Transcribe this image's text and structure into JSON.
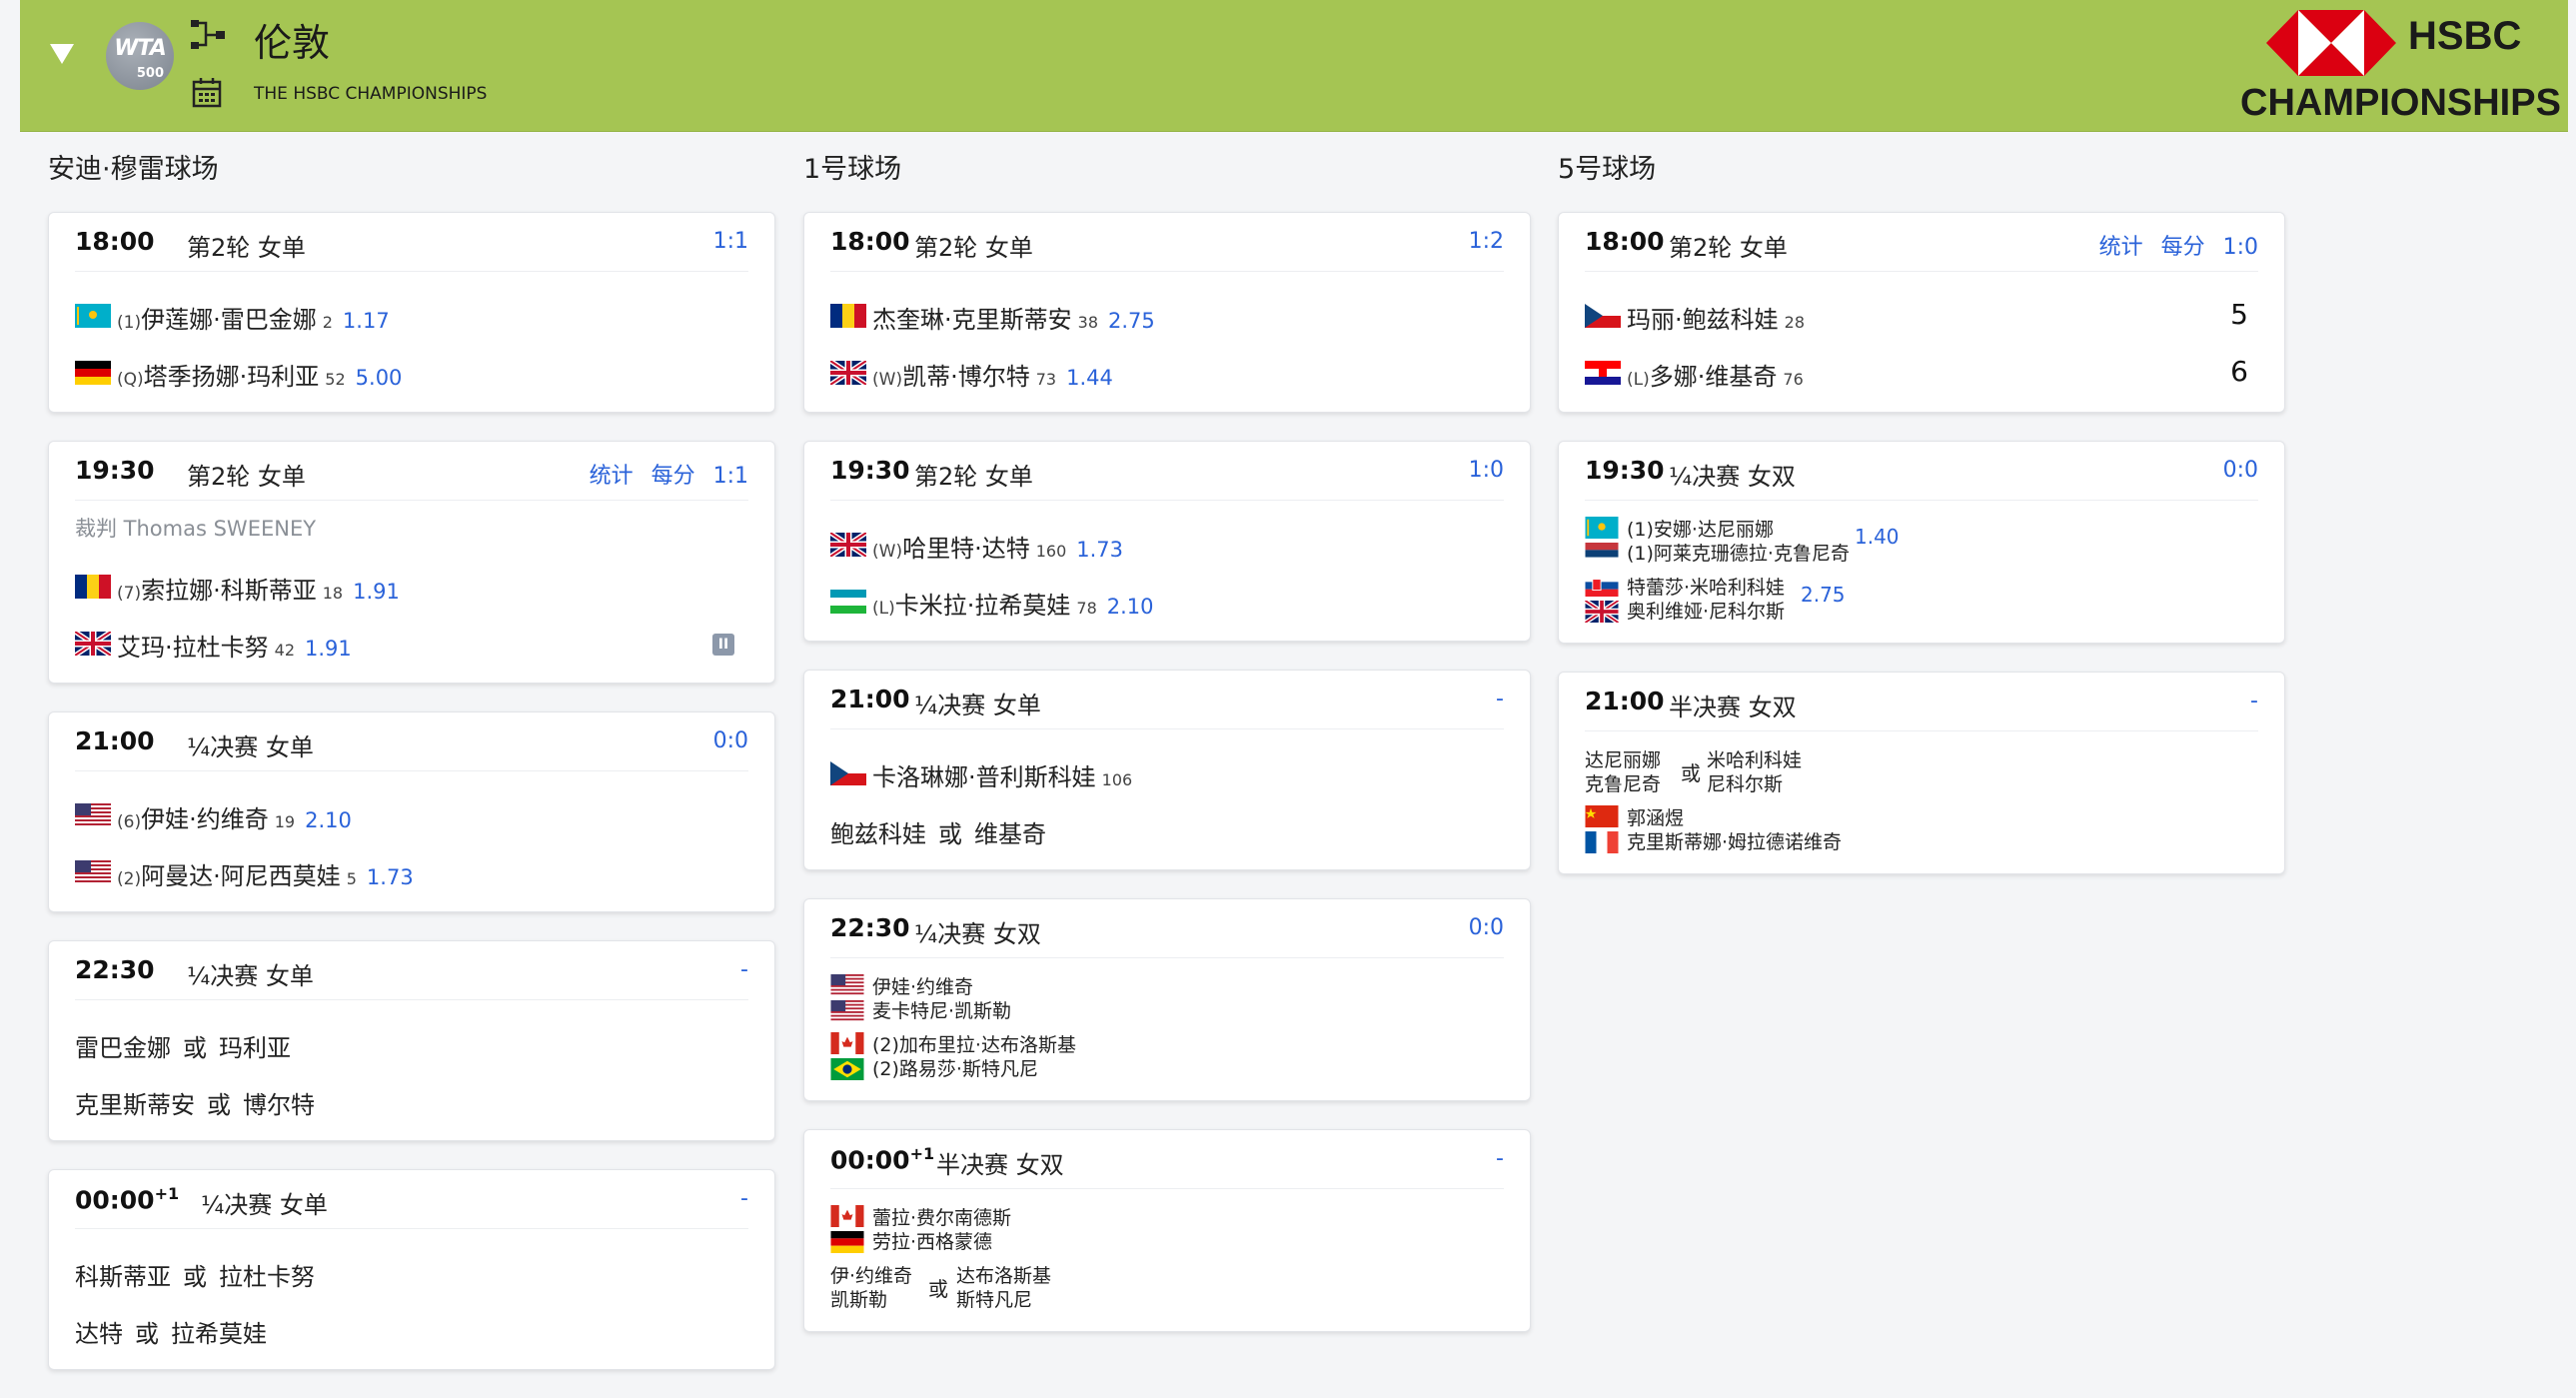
{
  "header": {
    "title": "伦敦",
    "subtitle": "THE HSBC CHAMPIONSHIPS",
    "logo_text": "WTA",
    "logo_tier": "500",
    "sponsor_word": "HSBC",
    "sponsor_champ": "CHAMPIONSHIPS",
    "icons": [
      "collapse-arrow-icon",
      "bracket-icon",
      "calendar-icon"
    ]
  },
  "courts": [
    {
      "title": "安迪·穆雷球场",
      "matches": [
        {
          "time": "18:00",
          "round": "第2轮 女单",
          "score": "1:1",
          "players": [
            {
              "flag": "KZ",
              "seed": "(1)",
              "name": "伊莲娜·雷巴金娜",
              "rank": "2",
              "odds": "1.17"
            },
            {
              "flag": "DE",
              "seed": "(Q)",
              "name": "塔季扬娜·玛利亚",
              "rank": "52",
              "odds": "5.00"
            }
          ]
        },
        {
          "time": "19:30",
          "round": "第2轮 女单",
          "stats": "统计",
          "perpoint": "每分",
          "score": "1:1",
          "referee": "裁判  Thomas SWEENEY",
          "players": [
            {
              "flag": "RO",
              "seed": "(7)",
              "name": "索拉娜·科斯蒂亚",
              "rank": "18",
              "odds": "1.91"
            },
            {
              "flag": "GB",
              "seed": "",
              "name": "艾玛·拉杜卡努",
              "rank": "42",
              "odds": "1.91"
            }
          ]
        },
        {
          "time": "21:00",
          "round": "¼决赛 女单",
          "score": "0:0",
          "players": [
            {
              "flag": "US",
              "seed": "(6)",
              "name": "伊娃·约维奇",
              "rank": "19",
              "odds": "2.10"
            },
            {
              "flag": "US",
              "seed": "(2)",
              "name": "阿曼达·阿尼西莫娃",
              "rank": "5",
              "odds": "1.73"
            }
          ]
        },
        {
          "time": "22:30",
          "round": "¼决赛 女单",
          "score": "-",
          "pending": [
            {
              "a": "雷巴金娜",
              "or": "或",
              "b": "玛利亚"
            },
            {
              "a": "克里斯蒂安",
              "or": "或",
              "b": "博尔特"
            }
          ]
        },
        {
          "time": "00:00",
          "plus": "+1",
          "round": "¼决赛 女单",
          "score": "-",
          "pending": [
            {
              "a": "科斯蒂亚",
              "or": "或",
              "b": "拉杜卡努"
            },
            {
              "a": "达特",
              "or": "或",
              "b": "拉希莫娃"
            }
          ]
        }
      ]
    },
    {
      "title": "1号球场",
      "matches": [
        {
          "time": "18:00",
          "round": "第2轮 女单",
          "score": "1:2",
          "players": [
            {
              "flag": "RO",
              "seed": "",
              "name": "杰奎琳·克里斯蒂安",
              "rank": "38",
              "odds": "2.75"
            },
            {
              "flag": "GB",
              "seed": "(W)",
              "name": "凯蒂·博尔特",
              "rank": "73",
              "odds": "1.44"
            }
          ]
        },
        {
          "time": "19:30",
          "round": "第2轮 女单",
          "score": "1:0",
          "players": [
            {
              "flag": "GB",
              "seed": "(W)",
              "name": "哈里特·达特",
              "rank": "160",
              "odds": "1.73"
            },
            {
              "flag": "UZ",
              "seed": "(L)",
              "name": "卡米拉·拉希莫娃",
              "rank": "78",
              "odds": "2.10"
            }
          ]
        },
        {
          "time": "21:00",
          "round": "¼决赛 女单",
          "score": "-",
          "player": {
            "flag": "CZ",
            "name": "卡洛琳娜·普利斯科娃",
            "rank": "106"
          },
          "pending": {
            "a": "鲍兹科娃",
            "or": "或",
            "b": "维基奇"
          }
        },
        {
          "time": "22:30",
          "round": "¼决赛 女双",
          "score": "0:0",
          "pairs": [
            {
              "flags": [
                "US",
                "US"
              ],
              "n1": "伊娃·约维奇",
              "n2": "麦卡特尼·凯斯勒"
            },
            {
              "flags": [
                "CA",
                "BR"
              ],
              "n1": "(2)加布里拉·达布洛斯基",
              "n2": "(2)路易莎·斯特凡尼"
            }
          ]
        },
        {
          "time": "00:00",
          "plus": "+1",
          "round": "半决赛 女双",
          "score": "-",
          "pair": {
            "flags": [
              "CA",
              "DE"
            ],
            "n1": "蕾拉·费尔南德斯",
            "n2": "劳拉·西格蒙德"
          },
          "pending": {
            "a1": "伊·约维奇",
            "a2": "凯斯勒",
            "or": "或",
            "b1": "达布洛斯基",
            "b2": "斯特凡尼"
          }
        }
      ]
    },
    {
      "title": "5号球场",
      "matches": [
        {
          "time": "18:00",
          "round": "第2轮 女单",
          "stats": "统计",
          "perpoint": "每分",
          "score": "1:0",
          "players": [
            {
              "flag": "CZ",
              "seed": "",
              "name": "玛丽·鲍兹科娃",
              "rank": "28",
              "set": "5"
            },
            {
              "flag": "HR",
              "seed": "(L)",
              "name": "多娜·维基奇",
              "rank": "76",
              "set": "6"
            }
          ]
        },
        {
          "time": "19:30",
          "round": "¼决赛 女双",
          "score": "0:0",
          "pairs": [
            {
              "flags": [
                "KZ",
                "RS"
              ],
              "n1": "(1)安娜·达尼丽娜",
              "n2": "(1)阿莱克珊德拉·克鲁尼奇",
              "odds": "1.40"
            },
            {
              "flags": [
                "SK",
                "GB"
              ],
              "n1": "特蕾莎·米哈利科娃",
              "n2": "奥利维娅·尼科尔斯",
              "odds": "2.75"
            }
          ]
        },
        {
          "time": "21:00",
          "round": "半决赛 女双",
          "score": "-",
          "pending": {
            "a1": "达尼丽娜",
            "a2": "克鲁尼奇",
            "or": "或",
            "b1": "米哈利科娃",
            "b2": "尼科尔斯"
          },
          "pair": {
            "flags": [
              "CN",
              "FR"
            ],
            "n1": "郭涵煜",
            "n2": "克里斯蒂娜·姆拉德诺维奇"
          }
        }
      ]
    }
  ],
  "colors": {
    "header_bg": "#a5c553",
    "link": "#2a62d9",
    "hsbc_red": "#db0011"
  }
}
